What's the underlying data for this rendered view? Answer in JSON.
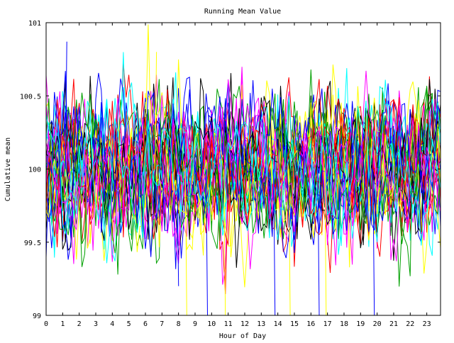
{
  "chart_data": {
    "type": "line",
    "title": "Running Mean Value",
    "xlabel": "Hour of Day",
    "ylabel": "Cumulative mean",
    "xlim": [
      0,
      23.83
    ],
    "ylim": [
      99,
      101
    ],
    "x_ticks": [
      0,
      1,
      2,
      3,
      4,
      5,
      6,
      7,
      8,
      9,
      10,
      11,
      12,
      13,
      14,
      15,
      16,
      17,
      18,
      19,
      20,
      21,
      22,
      23
    ],
    "x_tick_labels": [
      "0",
      "1",
      "2",
      "3",
      "4",
      "5",
      "6",
      "7",
      "8",
      "9",
      "10",
      "11",
      "12",
      "13",
      "14",
      "15",
      "16",
      "17",
      "18",
      "19",
      "20",
      "21",
      "22",
      "23"
    ],
    "y_ticks": [
      99,
      99.5,
      100,
      100.5,
      101
    ],
    "y_tick_labels": [
      "99",
      "99.5",
      "100",
      "100.5",
      "101"
    ],
    "grid": false,
    "legend": "none",
    "series_count": 40,
    "points_per_hour": 6,
    "center_value": 100,
    "typical_range": [
      99.5,
      100.5
    ],
    "series_colors": [
      "#ff0000",
      "#00a000",
      "#0000ff",
      "#ff00ff",
      "#00ffff",
      "#ffff00",
      "#000000"
    ],
    "notable_extremes": [
      {
        "x": 1.25,
        "y": 100.87
      },
      {
        "x": 6.67,
        "y": 100.8
      },
      {
        "x": 8.0,
        "y": 99.2
      },
      {
        "x": 8.5,
        "y": 99.0
      },
      {
        "x": 9.75,
        "y": 99.0
      },
      {
        "x": 10.83,
        "y": 99.0
      },
      {
        "x": 13.83,
        "y": 99.0
      },
      {
        "x": 14.75,
        "y": 99.0
      },
      {
        "x": 16.5,
        "y": 99.0
      },
      {
        "x": 16.92,
        "y": 99.0
      },
      {
        "x": 19.83,
        "y": 99.0
      }
    ]
  }
}
